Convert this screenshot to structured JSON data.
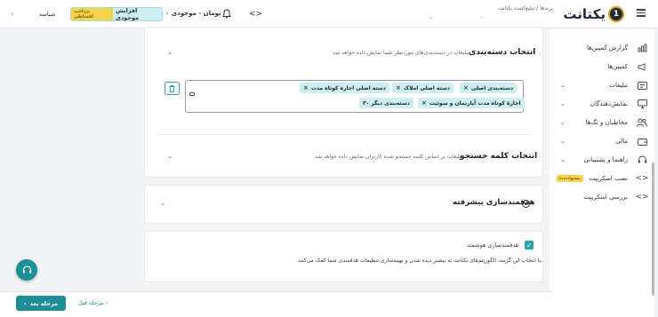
{
  "header": {
    "advertiser_label": "برندها / تبلیغ‌کننده یکتانت",
    "advertiser_value": "-",
    "logo_text": "یکتانت",
    "logo_number": "1",
    "balance_label": "موجودی",
    "balance_value": "۰ تومان",
    "increase_balance": "افزایش موجودی",
    "increase_tag": "پرداخت اقساطی",
    "profile": "شناسه"
  },
  "sidebar": {
    "items": [
      {
        "label": "گزارش کمپین‌ها",
        "icon": "chart-icon"
      },
      {
        "label": "کمپین‌ها",
        "icon": "megaphone-icon"
      },
      {
        "label": "تبلیغات",
        "icon": "ad-icon"
      },
      {
        "label": "نمایش‌دهندگان",
        "icon": "monitor-icon"
      },
      {
        "label": "مخاطبان و تگ‌ها",
        "icon": "users-icon"
      },
      {
        "label": "مالی",
        "icon": "wallet-icon"
      },
      {
        "label": "راهنما و پشتیبانی",
        "icon": "headset-icon"
      },
      {
        "label": "نصب اسکریپت",
        "icon": "code-icon",
        "badge": "پیشنهادشده"
      },
      {
        "label": "بررسی اسکریپت",
        "icon": "code-icon"
      }
    ]
  },
  "category_section": {
    "title": "انتخاب دسته‌بندی",
    "description": "تبلیغات در دسته‌بندی‌های موردنظر شما نمایش داده خواهد شد.",
    "tags": [
      "دسته‌بندی اصلی",
      "دسته اصلی املاک",
      "دسته اصلی اجاره کوتاه مدت",
      "اجارهٔ کوتاه مدت آپارتمان و سوئیت",
      "۳۰ دسته‌بندی دیگر"
    ]
  },
  "keyword_section": {
    "title": "انتخاب کلمه جستجو",
    "description": "تبلیغات بر اساس کلمه جستجو شده کاربران نمایش داده خواهد شد."
  },
  "advanced_section": {
    "title": "هدفمندسازی پیشرفته"
  },
  "smart_section": {
    "title": "هدفمندسازی هوشمند",
    "description": "با انتخاب این گزینه، الگوریتم‌های یکتانت به بیشتر دیده شدن و بهینه‌سازی تنظیمات هدفمندی شما کمک می‌کنند."
  },
  "footer": {
    "next": "مرحله بعد",
    "prev": "مرحله قبل"
  },
  "colors": {
    "accent": "#1f8f97",
    "chip_bg": "#cdeff2",
    "badge_yellow": "#f6d34a"
  }
}
